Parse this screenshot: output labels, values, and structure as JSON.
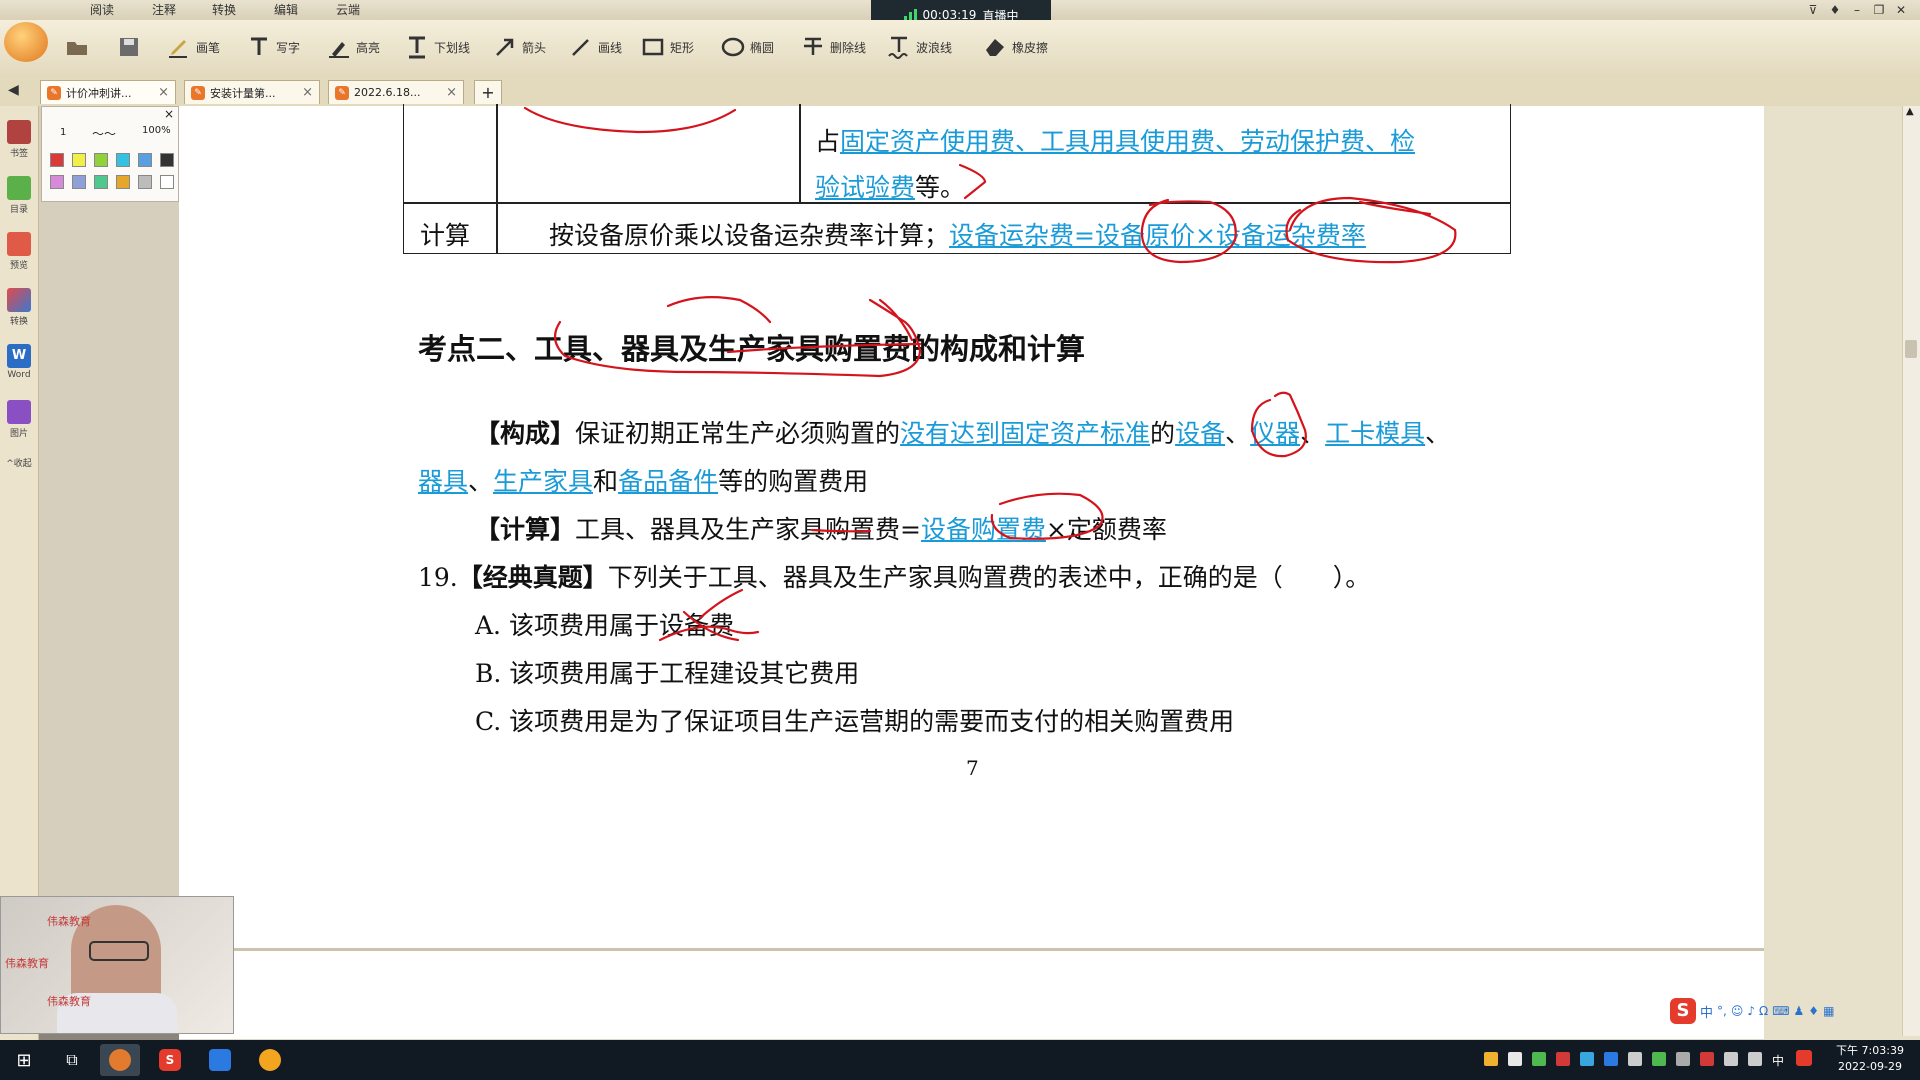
{
  "menu": {
    "tabs": [
      "阅读",
      "注释",
      "转换",
      "编辑",
      "云端"
    ]
  },
  "recording": {
    "time": "00:03:19",
    "status": "直播中"
  },
  "toolbar": {
    "tools": [
      {
        "icon": "folder-open-icon",
        "label": ""
      },
      {
        "icon": "save-icon",
        "label": ""
      },
      {
        "icon": "pen-icon",
        "label": "画笔"
      },
      {
        "icon": "text-tool-icon",
        "label": "写字"
      },
      {
        "icon": "highlighter-icon",
        "label": "高亮"
      },
      {
        "icon": "underline-icon",
        "label": "下划线"
      },
      {
        "icon": "arrow-tool-icon",
        "label": "箭头"
      },
      {
        "icon": "line-tool-icon",
        "label": "画线"
      },
      {
        "icon": "rectangle-tool-icon",
        "label": "矩形"
      },
      {
        "icon": "ellipse-tool-icon",
        "label": "椭圆"
      },
      {
        "icon": "strikethrough-icon",
        "label": "删除线"
      },
      {
        "icon": "wavy-line-icon",
        "label": "波浪线"
      },
      {
        "icon": "eraser-icon",
        "label": "橡皮擦"
      }
    ]
  },
  "tabs": [
    {
      "label": "计价冲刺讲...",
      "close": "×"
    },
    {
      "label": "安装计量第...",
      "close": "×"
    },
    {
      "label": "2022.6.18...",
      "close": "×"
    }
  ],
  "new_tab": "+",
  "rail": [
    {
      "label": "书签"
    },
    {
      "label": "目录"
    },
    {
      "label": "预览"
    },
    {
      "label": "转换"
    },
    {
      "label": "Word"
    },
    {
      "label": "图片"
    },
    {
      "label": "^收起"
    }
  ],
  "palette": {
    "width_value": "1",
    "zoom": "100%",
    "close": "×",
    "colors": [
      "#d93a3a",
      "#f2ee4a",
      "#8fd23c",
      "#34c2e0",
      "#5aa0e0",
      "#333333",
      "#d68ad8",
      "#8fa0d8",
      "#4fc890",
      "#e6a62a",
      "#bcbcbc",
      "#ffffff"
    ]
  },
  "document": {
    "row1": {
      "prefix": "占",
      "links_line1": "固定资产使用费、工具用具使用费、劳动保护费、检",
      "links_line2": "验试验费",
      "suffix": "等。"
    },
    "row2": {
      "label": "计算",
      "text": "按设备原价乘以设备运杂费率计算；",
      "formula": "设备运杂费=设备原价×设备运杂费率"
    },
    "heading": "考点二、工具、器具及生产家具购置费的构成和计算",
    "composition": {
      "tag": "【构成】",
      "text1": "保证初期正常生产必须购置的",
      "link1": "没有达到固定资产标准",
      "text2": "的",
      "link2": "设备",
      "sep1": "、",
      "link3": "仪器",
      "sep2": "、",
      "link4": "工卡模具",
      "sep3": "、",
      "link5": "器具",
      "sep4": "、",
      "link6": "生产家具",
      "text3": "和",
      "link7": "备品备件",
      "text4": "等的购置费用"
    },
    "calculation": {
      "tag": "【计算】",
      "text1": "工具、器具及生产家具购置费=",
      "link": "设备购置费",
      "text2": "×定额费率"
    },
    "question": {
      "number": "19.",
      "tag": "【经典真题】",
      "text": "下列关于工具、器具及生产家具购置费的表述中，正确的是（　　）。",
      "options": [
        "A. 该项费用属于设备费",
        "B. 该项费用属于工程建设其它费用",
        "C. 该项费用是为了保证项目生产运营期的需要而支付的相关购置费用"
      ]
    },
    "page_number": "7",
    "annotation_color": "#d4141c"
  },
  "webcam": {
    "watermark": "伟森教育"
  },
  "ime": {
    "logo": "S",
    "mode": "中"
  },
  "taskbar": {
    "ime_mode": "中",
    "time": "下午 7:03:39",
    "date": "2022-09-29"
  }
}
